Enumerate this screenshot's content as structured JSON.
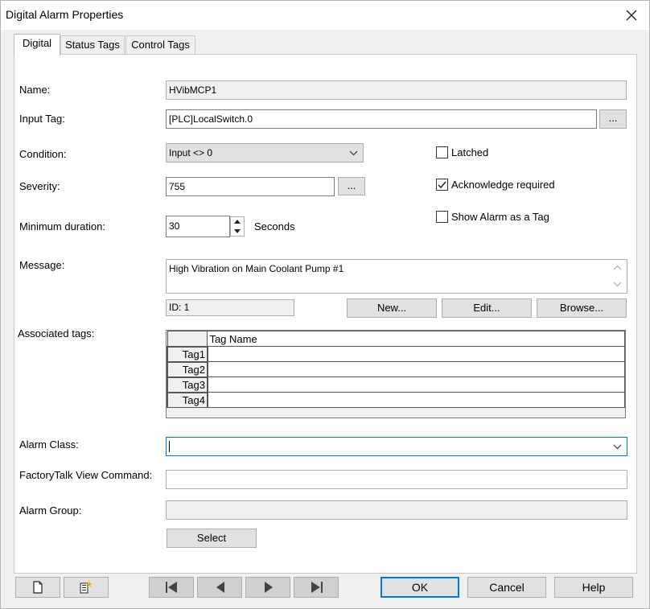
{
  "window": {
    "title": "Digital Alarm Properties"
  },
  "tabs": [
    {
      "label": "Digital",
      "active": true
    },
    {
      "label": "Status Tags"
    },
    {
      "label": "Control Tags"
    }
  ],
  "form": {
    "name": {
      "label": "Name:",
      "value": "HVibMCP1"
    },
    "input_tag": {
      "label": "Input Tag:",
      "value": "[PLC]LocalSwitch.0",
      "browse_label": "..."
    },
    "condition": {
      "label": "Condition:",
      "value": "Input <> 0"
    },
    "severity": {
      "label": "Severity:",
      "value": "755",
      "browse_label": "..."
    },
    "min_duration": {
      "label": "Minimum duration:",
      "value": "30",
      "unit": "Seconds"
    },
    "latched": {
      "label": "Latched",
      "checked": false
    },
    "ack_required": {
      "label": "Acknowledge required",
      "checked": true
    },
    "show_as_tag": {
      "label": "Show Alarm as a Tag",
      "checked": false
    },
    "message": {
      "label": "Message:",
      "value": "High Vibration on Main Coolant Pump #1",
      "id_text": "ID: 1"
    },
    "message_buttons": {
      "new": "New...",
      "edit": "Edit...",
      "browse": "Browse..."
    },
    "associated_tags": {
      "label": "Associated tags:",
      "column_header": "Tag Name",
      "rows": [
        {
          "label": "Tag1",
          "value": ""
        },
        {
          "label": "Tag2",
          "value": ""
        },
        {
          "label": "Tag3",
          "value": ""
        },
        {
          "label": "Tag4",
          "value": ""
        }
      ]
    },
    "alarm_class": {
      "label": "Alarm Class:",
      "value": ""
    },
    "ftview_command": {
      "label": "FactoryTalk View Command:",
      "value": ""
    },
    "alarm_group": {
      "label": "Alarm Group:",
      "value": ""
    },
    "select_label": "Select"
  },
  "footer": {
    "ok": "OK",
    "cancel": "Cancel",
    "help": "Help"
  },
  "colors": {
    "focus_border": "#0078d7",
    "button_bg": "#e1e1e1",
    "window_bg": "#f0f0f0"
  }
}
